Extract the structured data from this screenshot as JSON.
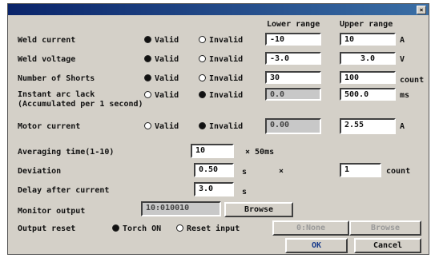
{
  "window": {
    "close_glyph": "×"
  },
  "headers": {
    "lower": "Lower range",
    "upper": "Upper range"
  },
  "rows": [
    {
      "label": "Weld current",
      "valid": "Valid",
      "invalid": "Invalid",
      "selected": "valid",
      "lower": "-10",
      "upper": "10",
      "unit": "A",
      "lower_disabled": false
    },
    {
      "label": "Weld voltage",
      "valid": "Valid",
      "invalid": "Invalid",
      "selected": "valid",
      "lower": "-3.0",
      "upper": "3.0",
      "unit": "V",
      "lower_disabled": false
    },
    {
      "label": "Number of Shorts",
      "valid": "Valid",
      "invalid": "Invalid",
      "selected": "valid",
      "lower": "30",
      "upper": "100",
      "unit": "count",
      "lower_disabled": false
    },
    {
      "label": "Instant arc lack",
      "sublabel": "(Accumulated per 1 second)",
      "valid": "Valid",
      "invalid": "Invalid",
      "selected": "invalid",
      "lower": "0.0",
      "upper": "500.0",
      "unit": "ms",
      "lower_disabled": true
    },
    {
      "label": "Motor current",
      "valid": "Valid",
      "invalid": "Invalid",
      "selected": "invalid",
      "lower": "0.00",
      "upper": "2.55",
      "unit": "A",
      "lower_disabled": true
    }
  ],
  "averaging": {
    "label": "Averaging time(1-10)",
    "value": "10",
    "unit": "× 50ms"
  },
  "deviation": {
    "label": "Deviation",
    "value": "0.50",
    "unit": "s",
    "times": "×",
    "count_value": "1",
    "count_unit": "count"
  },
  "delay": {
    "label": "Delay after current",
    "value": "3.0",
    "unit": "s"
  },
  "monitor": {
    "label": "Monitor output",
    "value": "10:010010",
    "browse": "Browse"
  },
  "output_reset": {
    "label": "Output reset",
    "torch": "Torch ON",
    "reset": "Reset input",
    "selected": "torch",
    "none_field": "0:None",
    "browse": "Browse"
  },
  "buttons": {
    "ok": "OK",
    "cancel": "Cancel"
  }
}
